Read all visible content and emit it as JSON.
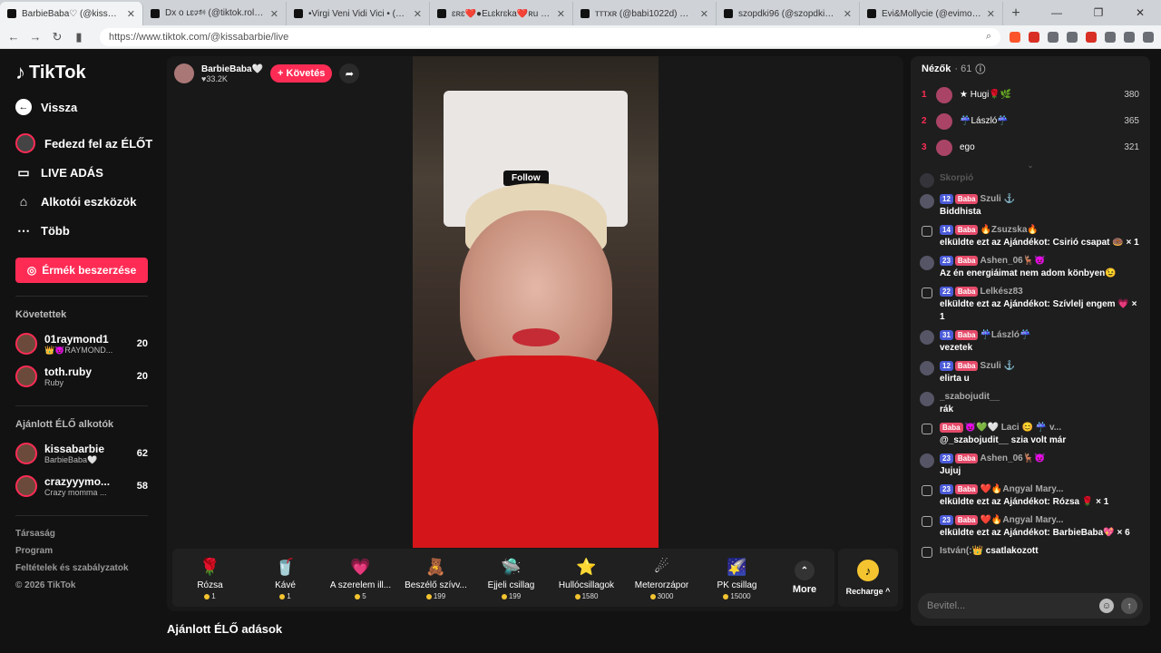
{
  "browser": {
    "tabs": [
      {
        "title": "BarbieBaba♡ (@kissabarbi",
        "active": true
      },
      {
        "title": "Dx o ʟɛ🕬 (@tiktok.roli) ÉLŐ adá",
        "active": false
      },
      {
        "title": "•Virgi Veni Vidi Vici • (@virgivenivic",
        "active": false
      },
      {
        "title": "ɛʀɛ❤️●Eʟɛkrɛka❤️ʀu (@eurekaeuri",
        "active": false
      },
      {
        "title": "ᴛᴛᴛxʀ (@babi1022d) ÉLŐ adásb",
        "active": false
      },
      {
        "title": "szopdki96 (@szopdki96) ÉLŐ adá",
        "active": false
      },
      {
        "title": "Evi&Mollycie (@evimolly2) ÉLŐ adá",
        "active": false
      }
    ],
    "new_tab": "+",
    "url": "https://www.tiktok.com/@kissabarbie/live"
  },
  "sidebar": {
    "logo": "TikTok",
    "back": "Vissza",
    "nav": [
      {
        "label": "Fedezd fel az ÉLŐT",
        "icon": "live-avatar-icon"
      },
      {
        "label": "LIVE ADÁS",
        "icon": "camera-icon"
      },
      {
        "label": "Alkotói eszközök",
        "icon": "home-icon"
      },
      {
        "label": "Több",
        "icon": "more-icon"
      }
    ],
    "coins_button": "Érmék beszerzése",
    "following_title": "Követettek",
    "following": [
      {
        "name": "01raymond1",
        "sub": "👑😈RAYMOND...",
        "count": "20"
      },
      {
        "name": "toth.ruby",
        "sub": "Ruby",
        "count": "20"
      }
    ],
    "recommended_title": "Ajánlott ÉLŐ alkotók",
    "recommended": [
      {
        "name": "kissabarbie",
        "sub": "BarbieBaba🤍",
        "count": "62"
      },
      {
        "name": "crazyyymo...",
        "sub": "Crazy momma ...",
        "count": "58"
      }
    ],
    "footer": [
      "Társaság",
      "Program",
      "Feltételek és szabályzatok",
      "© 2026 TikTok"
    ]
  },
  "player": {
    "host_name": "BarbieBaba🤍",
    "host_likes": "♥33.2K",
    "follow_button": "+ Követés",
    "video_overlay_follow": "Follow",
    "gifts": [
      {
        "name": "Rózsa",
        "price": "1",
        "icon": "🌹"
      },
      {
        "name": "Kávé",
        "price": "1",
        "icon": "🥤"
      },
      {
        "name": "A szerelem ill...",
        "price": "5",
        "icon": "💗"
      },
      {
        "name": "Beszélő szívv...",
        "price": "199",
        "icon": "🧸"
      },
      {
        "name": "Éjjeli csillag",
        "price": "199",
        "icon": "🛸"
      },
      {
        "name": "Hullócsillagok",
        "price": "1580",
        "icon": "⭐"
      },
      {
        "name": "Meterorzápor",
        "price": "3000",
        "icon": "☄"
      },
      {
        "name": "PK csillag",
        "price": "15000",
        "icon": "🌠"
      }
    ],
    "more_label": "More",
    "recharge_label": "Recharge ^"
  },
  "below_title": "Ajánlott ÉLŐ adások",
  "chat": {
    "viewers_label": "Nézők",
    "viewers_count": "· 61",
    "top_viewers": [
      {
        "rank": "1",
        "name": "★ Hugi🌹🌿",
        "score": "380"
      },
      {
        "rank": "2",
        "name": "☔László☔",
        "score": "365"
      },
      {
        "rank": "3",
        "name": "ego",
        "score": "321"
      }
    ],
    "faded_name": "Skorpió",
    "messages": [
      {
        "type": "user",
        "level": "12",
        "fan": "Baba",
        "name": "Szuli ⚓",
        "text": "Biddhista"
      },
      {
        "type": "gift",
        "level": "14",
        "fan": "Baba",
        "name": "🔥Zsuzska🔥",
        "text": "elküldte ezt az Ajándékot: Csirió csapat 🍩 × 1"
      },
      {
        "type": "user",
        "level": "23",
        "fan": "Baba",
        "name": "Ashen_06🦌😈",
        "text": "Az én energiáimat nem adom könbyen😉"
      },
      {
        "type": "gift",
        "level": "22",
        "fan": "Baba",
        "name": "Lelkész83",
        "text": "elküldte ezt az Ajándékot: Szívlelj engem 💗 × 1"
      },
      {
        "type": "user",
        "level": "31",
        "fan": "Baba",
        "name": "☔László☔",
        "text": "vezetek"
      },
      {
        "type": "user",
        "level": "12",
        "fan": "Baba",
        "name": "Szuli ⚓",
        "text": "elirta u"
      },
      {
        "type": "user",
        "level": "",
        "fan": "",
        "name": "_szabojudit__",
        "text": "rák"
      },
      {
        "type": "gift",
        "level": "",
        "fan": "Baba",
        "name": "😈💚🤍 Laci 😊 ☔ v...",
        "text": "@_szabojudit__ szia volt már"
      },
      {
        "type": "user",
        "level": "23",
        "fan": "Baba",
        "name": "Ashen_06🦌😈",
        "text": "Jujuj"
      },
      {
        "type": "gift",
        "level": "23",
        "fan": "Baba",
        "name": "❤️🔥Angyal Mary...",
        "text": "elküldte ezt az Ajándékot: Rózsa 🌹 × 1"
      },
      {
        "type": "gift",
        "level": "23",
        "fan": "Baba",
        "name": "❤️🔥Angyal Mary...",
        "text": "elküldte ezt az Ajándékot: BarbieBaba💖 × 6"
      },
      {
        "type": "join",
        "level": "",
        "fan": "",
        "name": "István(:👑",
        "text": "csatlakozott"
      }
    ],
    "input_placeholder": "Bevitel..."
  }
}
